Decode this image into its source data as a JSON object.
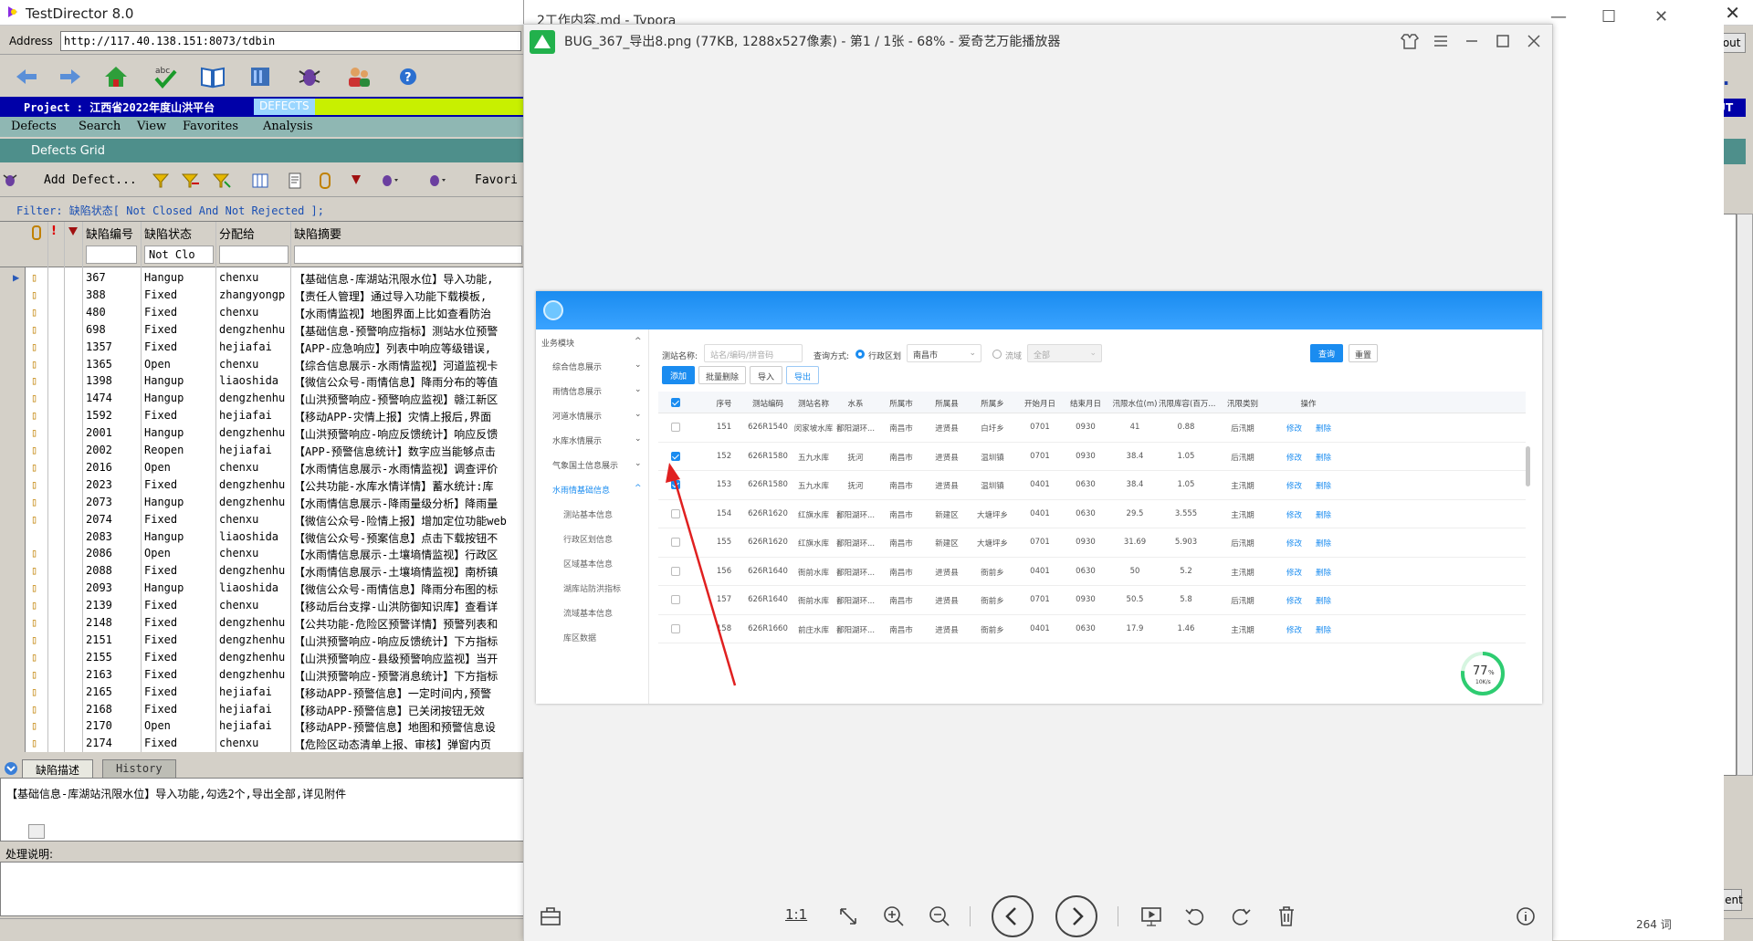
{
  "td": {
    "window_title": "TestDirector 8.0",
    "address_label": "Address",
    "address_value": "http://117.40.138.151:8073/tdbin",
    "project_label": "Project : 江西省2022年度山洪平台",
    "module_badge": "DEFECTS",
    "menu": [
      "Defects",
      "Search",
      "View",
      "Favorites",
      "Analysis"
    ],
    "grid_title": "Defects Grid",
    "add_defect": "Add Defect...",
    "favorites": "Favori",
    "filter_text": "Filter: 缺陷状态[ Not  Closed  And  Not  Rejected ];",
    "columns": {
      "id": "缺陷编号",
      "status": "缺陷状态",
      "assignee": "分配给",
      "summary": "缺陷摘要"
    },
    "status_filter": "Not  Clo",
    "rows": [
      {
        "id": "367",
        "status": "Hangup",
        "assignee": "chenxu",
        "summary": "【基础信息-库湖站汛限水位】导入功能,"
      },
      {
        "id": "388",
        "status": "Fixed",
        "assignee": "zhangyongp",
        "summary": "【责任人管理】通过导入功能下载模板,"
      },
      {
        "id": "480",
        "status": "Fixed",
        "assignee": "chenxu",
        "summary": "【水雨情监视】地图界面上比如查看防治"
      },
      {
        "id": "698",
        "status": "Fixed",
        "assignee": "dengzhenhu",
        "summary": "【基础信息-预警响应指标】测站水位预警"
      },
      {
        "id": "1357",
        "status": "Fixed",
        "assignee": "hejiafai",
        "summary": "【APP-应急响应】列表中响应等级错误,"
      },
      {
        "id": "1365",
        "status": "Open",
        "assignee": "chenxu",
        "summary": "【综合信息展示-水雨情监视】河道监视卡"
      },
      {
        "id": "1398",
        "status": "Hangup",
        "assignee": "liaoshida",
        "summary": "【微信公众号-雨情信息】降雨分布的等值"
      },
      {
        "id": "1474",
        "status": "Hangup",
        "assignee": "dengzhenhu",
        "summary": "【山洪预警响应-预警响应监视】赣江新区"
      },
      {
        "id": "1592",
        "status": "Fixed",
        "assignee": "hejiafai",
        "summary": "【移动APP-灾情上报】灾情上报后,界面"
      },
      {
        "id": "2001",
        "status": "Hangup",
        "assignee": "dengzhenhu",
        "summary": "【山洪预警响应-响应反馈统计】响应反馈"
      },
      {
        "id": "2002",
        "status": "Reopen",
        "assignee": "hejiafai",
        "summary": "【APP-预警信息统计】数字应当能够点击"
      },
      {
        "id": "2016",
        "status": "Open",
        "assignee": "chenxu",
        "summary": "【水雨情信息展示-水雨情监视】调查评价"
      },
      {
        "id": "2023",
        "status": "Fixed",
        "assignee": "dengzhenhu",
        "summary": "【公共功能-水库水情详情】蓄水统计:库"
      },
      {
        "id": "2073",
        "status": "Hangup",
        "assignee": "dengzhenhu",
        "summary": "【水雨情信息展示-降雨量级分析】降雨量"
      },
      {
        "id": "2074",
        "status": "Fixed",
        "assignee": "chenxu",
        "summary": "【微信公众号-险情上报】增加定位功能web"
      },
      {
        "id": "2083",
        "status": "Hangup",
        "assignee": "liaoshida",
        "summary": "【微信公众号-预案信息】点击下载按钮不"
      },
      {
        "id": "2086",
        "status": "Open",
        "assignee": "chenxu",
        "summary": "【水雨情信息展示-土壤墒情监视】行政区"
      },
      {
        "id": "2088",
        "status": "Fixed",
        "assignee": "dengzhenhu",
        "summary": "【水雨情信息展示-土壤墒情监视】南桥镇"
      },
      {
        "id": "2093",
        "status": "Hangup",
        "assignee": "liaoshida",
        "summary": "【微信公众号-雨情信息】降雨分布图的标"
      },
      {
        "id": "2139",
        "status": "Fixed",
        "assignee": "chenxu",
        "summary": "【移动后台支撑-山洪防御知识库】查看详"
      },
      {
        "id": "2148",
        "status": "Fixed",
        "assignee": "dengzhenhu",
        "summary": "【公共功能-危险区预警详情】预警列表和"
      },
      {
        "id": "2151",
        "status": "Fixed",
        "assignee": "dengzhenhu",
        "summary": "【山洪预警响应-响应反馈统计】下方指标"
      },
      {
        "id": "2155",
        "status": "Fixed",
        "assignee": "dengzhenhu",
        "summary": "【山洪预警响应-县级预警响应监视】当开"
      },
      {
        "id": "2163",
        "status": "Fixed",
        "assignee": "dengzhenhu",
        "summary": "【山洪预警响应-预警消息统计】下方指标"
      },
      {
        "id": "2165",
        "status": "Fixed",
        "assignee": "hejiafai",
        "summary": "【移动APP-预警信息】一定时间内,预警"
      },
      {
        "id": "2168",
        "status": "Fixed",
        "assignee": "hejiafai",
        "summary": "【移动APP-预警信息】已关闭按钮无效"
      },
      {
        "id": "2170",
        "status": "Open",
        "assignee": "hejiafai",
        "summary": "【移动APP-预警信息】地图和预警信息设"
      },
      {
        "id": "2174",
        "status": "Fixed",
        "assignee": "chenxu",
        "summary": "【危险区动态清单上报、审核】弹窗内页"
      }
    ],
    "tab_desc": "缺陷描述",
    "tab_history": "History",
    "desc_text": "【基础信息-库湖站汛限水位】导入功能,勾选2个,导出全部,详见附件",
    "proc_label": "处理说明:",
    "about": "About",
    "logout": "OGOUT",
    "comment": "Comment"
  },
  "typora": {
    "title": "2工作内容.md - Typora",
    "word_count": "264 词"
  },
  "viewer": {
    "title": "BUG_367_导出8.png  (77KB, 1288x527像素)  - 第1 / 1张 - 68% - 爱奇艺万能播放器",
    "zoom_1to1": "1:1"
  },
  "shot": {
    "sidebar": {
      "root": "业务模块",
      "items": [
        "综合信息展示",
        "雨情信息展示",
        "河道水情展示",
        "水库水情展示",
        "气象国土信息展示",
        "水雨情基础信息"
      ],
      "subitems": [
        "测站基本信息",
        "行政区划信息",
        "区域基本信息",
        "湖库站防洪指标",
        "流域基本信息",
        "库区数据"
      ]
    },
    "query": {
      "station_label": "测站名称:",
      "station_placeholder": "站名/编码/拼音码",
      "mode_label": "查询方式:",
      "opt_admin": "行政区划",
      "admin_value": "南昌市",
      "opt_basin": "流域",
      "basin_value": "全部",
      "search_btn": "查询",
      "reset_btn": "重置"
    },
    "actions": {
      "add": "添加",
      "batch_delete": "批量删除",
      "import": "导入",
      "export": "导出"
    },
    "headers": [
      "序号",
      "测站编码",
      "测站名称",
      "水系",
      "所属市",
      "所属县",
      "所属乡",
      "开始月日",
      "结束月日",
      "汛限水位(m)",
      "汛限库容(百万...",
      "汛限类别",
      "操作"
    ],
    "row_edit": "修改",
    "row_delete": "删除",
    "rows": [
      {
        "no": "151",
        "code": "626R1540",
        "name": "闵家坡水库",
        "river": "鄱阳湖环...",
        "city": "南昌市",
        "county": "进贤县",
        "town": "白圩乡",
        "start": "0701",
        "end": "0930",
        "level": "41",
        "storage": "0.88",
        "type": "后汛期",
        "checked": false
      },
      {
        "no": "152",
        "code": "626R1580",
        "name": "五九水库",
        "river": "抚河",
        "city": "南昌市",
        "county": "进贤县",
        "town": "温圳镇",
        "start": "0701",
        "end": "0930",
        "level": "38.4",
        "storage": "1.05",
        "type": "后汛期",
        "checked": true
      },
      {
        "no": "153",
        "code": "626R1580",
        "name": "五九水库",
        "river": "抚河",
        "city": "南昌市",
        "county": "进贤县",
        "town": "温圳镇",
        "start": "0401",
        "end": "0630",
        "level": "38.4",
        "storage": "1.05",
        "type": "主汛期",
        "checked": true
      },
      {
        "no": "154",
        "code": "626R1620",
        "name": "红旗水库",
        "river": "鄱阳湖环...",
        "city": "南昌市",
        "county": "新建区",
        "town": "大塘坪乡",
        "start": "0401",
        "end": "0630",
        "level": "29.5",
        "storage": "3.555",
        "type": "主汛期",
        "checked": false
      },
      {
        "no": "155",
        "code": "626R1620",
        "name": "红旗水库",
        "river": "鄱阳湖环...",
        "city": "南昌市",
        "county": "新建区",
        "town": "大塘坪乡",
        "start": "0701",
        "end": "0930",
        "level": "31.69",
        "storage": "5.903",
        "type": "后汛期",
        "checked": false
      },
      {
        "no": "156",
        "code": "626R1640",
        "name": "衙前水库",
        "river": "鄱阳湖环...",
        "city": "南昌市",
        "county": "进贤县",
        "town": "衙前乡",
        "start": "0401",
        "end": "0630",
        "level": "50",
        "storage": "5.2",
        "type": "主汛期",
        "checked": false
      },
      {
        "no": "157",
        "code": "626R1640",
        "name": "衙前水库",
        "river": "鄱阳湖环...",
        "city": "南昌市",
        "county": "进贤县",
        "town": "衙前乡",
        "start": "0701",
        "end": "0930",
        "level": "50.5",
        "storage": "5.8",
        "type": "后汛期",
        "checked": false
      },
      {
        "no": "158",
        "code": "626R1660",
        "name": "前庄水库",
        "river": "鄱阳湖环...",
        "city": "南昌市",
        "county": "进贤县",
        "town": "衙前乡",
        "start": "0401",
        "end": "0630",
        "level": "17.9",
        "storage": "1.46",
        "type": "主汛期",
        "checked": false
      }
    ],
    "gauge": {
      "value": 0.77,
      "label": "77",
      "unit": "%",
      "speed": "10K/s"
    }
  },
  "colors": {
    "accent": "#1a8cf0",
    "td_blue": "#0000a8",
    "td_teal": "#4e8f8b",
    "annotation_red": "#e02020"
  }
}
